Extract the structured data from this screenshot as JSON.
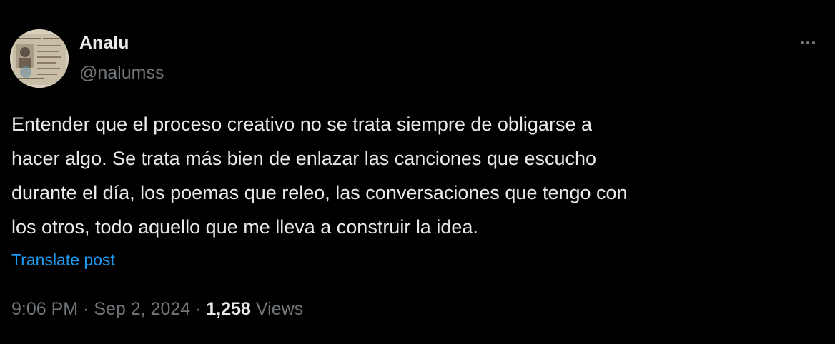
{
  "tweet": {
    "author": {
      "display_name": "Analu",
      "handle": "@nalumss",
      "avatar_icon": "profile-photo"
    },
    "more_icon": "more-options-icon",
    "text": "Entender que el proceso creativo no se trata siempre de obligarse a\nhacer algo. Se trata más bien de enlazar las canciones que escucho\ndurante el día, los poemas que releo, las conversaciones que tengo con\nlos otros, todo aquello que me lleva a construir la idea.",
    "translate_label": "Translate post",
    "meta": {
      "time": "9:06 PM",
      "separator": " · ",
      "date": "Sep 2, 2024",
      "views_count": "1,258",
      "views_label": "Views"
    }
  },
  "colors": {
    "background": "#000000",
    "text_primary": "#e7e9ea",
    "text_secondary": "#71767b",
    "link": "#1d9bf0"
  }
}
